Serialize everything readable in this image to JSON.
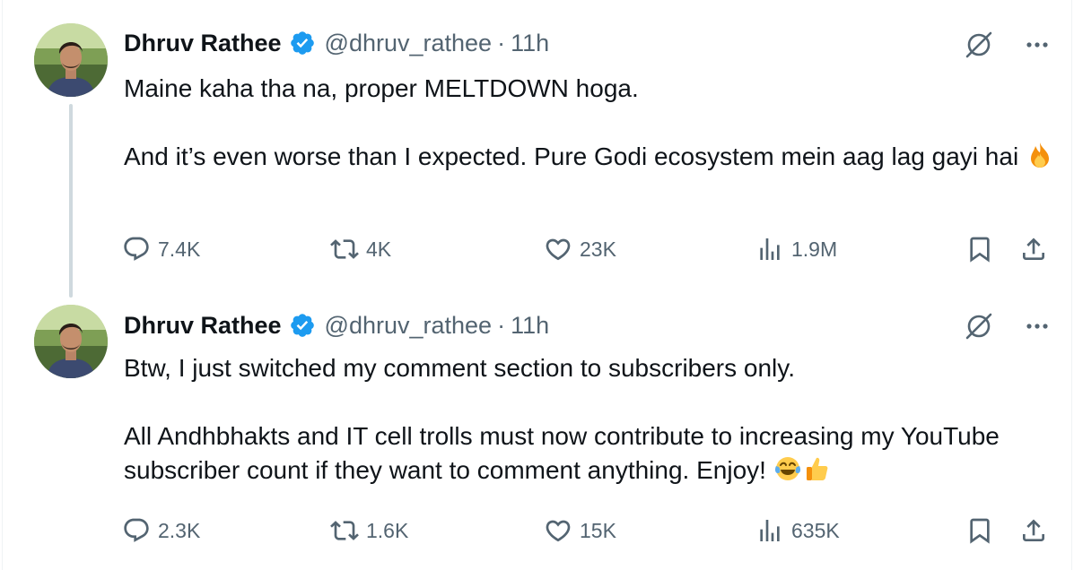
{
  "colors": {
    "text": "#0f1419",
    "secondary": "#536471",
    "verified_blue": "#1d9bf0",
    "thread_line": "#cfd9de"
  },
  "tweets": [
    {
      "author": {
        "name": "Dhruv Rathee",
        "handle": "@dhruv_rathee",
        "verified": true
      },
      "separator": "·",
      "time": "11h",
      "text_lines": [
        "Maine kaha tha na, proper MELTDOWN hoga.",
        "And it’s even worse than I expected. Pure Godi ecosystem mein aag lag gayi hai"
      ],
      "emojis": [
        "fire-emoji"
      ],
      "stats": {
        "replies": "7.4K",
        "reposts": "4K",
        "likes": "23K",
        "views": "1.9M"
      }
    },
    {
      "author": {
        "name": "Dhruv Rathee",
        "handle": "@dhruv_rathee",
        "verified": true
      },
      "separator": "·",
      "time": "11h",
      "text_lines": [
        "Btw, I just switched my comment section to subscribers only.",
        "All Andhbhakts and IT cell trolls must now contribute to increasing my YouTube subscriber count if they want to comment anything. Enjoy!"
      ],
      "emojis": [
        "tears-of-joy-emoji",
        "thumbs-up-emoji"
      ],
      "stats": {
        "replies": "2.3K",
        "reposts": "1.6K",
        "likes": "15K",
        "views": "635K"
      }
    }
  ]
}
